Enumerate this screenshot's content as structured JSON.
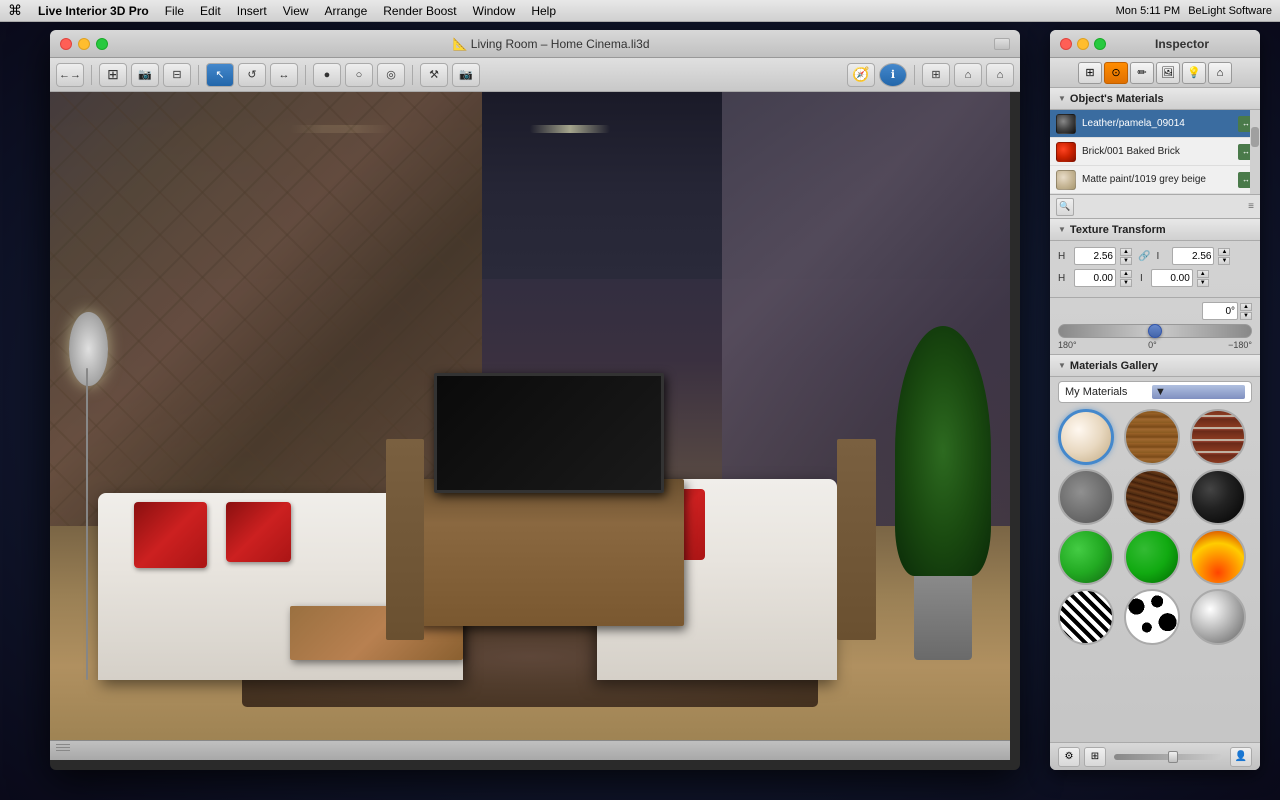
{
  "menubar": {
    "apple": "⌘",
    "items": [
      "Live Interior 3D Pro",
      "File",
      "Edit",
      "Insert",
      "View",
      "Arrange",
      "Render Boost",
      "Window",
      "Help"
    ],
    "right": {
      "time": "Mon 5:11 PM",
      "company": "BeLight Software"
    }
  },
  "window": {
    "title": "Living Room – Home Cinema.li3d",
    "traffic_lights": [
      "close",
      "minimize",
      "maximize"
    ]
  },
  "toolbar": {
    "buttons": [
      "←→",
      "⊞",
      "⊟",
      "⊠",
      "↖",
      "↺",
      "↔",
      "●",
      "○",
      "◎",
      "⚒",
      "📷",
      "🧭",
      "ℹ",
      "⊞",
      "⌂",
      "⌂"
    ]
  },
  "inspector": {
    "title": "Inspector",
    "tabs": [
      "obj",
      "mat",
      "edit",
      "tex",
      "light",
      "scene"
    ],
    "sections": {
      "objects_materials": {
        "label": "Object's Materials",
        "items": [
          {
            "name": "Leather/pamela_09014",
            "swatch_color": "#555555",
            "selected": true
          },
          {
            "name": "Brick/001 Baked Brick",
            "swatch_color": "#cc3300",
            "selected": false
          },
          {
            "name": "Matte paint/1019 grey beige",
            "swatch_color": "#d4c4a0",
            "selected": false
          }
        ]
      },
      "texture_transform": {
        "label": "Texture Transform",
        "fields": {
          "h1_label": "H",
          "h1_value": "2.56",
          "v1_label": "I",
          "v1_value": "2.56",
          "h2_label": "H",
          "h2_value": "0.00",
          "v2_label": "I",
          "v2_value": "0.00",
          "angle_label": "0°",
          "angle_min": "180°",
          "angle_zero": "0°",
          "angle_max": "−180°"
        }
      },
      "materials_gallery": {
        "label": "Materials Gallery",
        "dropdown_value": "My Materials",
        "items": [
          {
            "type": "cream",
            "label": "cream sphere"
          },
          {
            "type": "wood1",
            "label": "light wood"
          },
          {
            "type": "brick",
            "label": "brick"
          },
          {
            "type": "concrete",
            "label": "concrete"
          },
          {
            "type": "darkwood",
            "label": "dark wood"
          },
          {
            "type": "black",
            "label": "black"
          },
          {
            "type": "green1",
            "label": "green sphere"
          },
          {
            "type": "green2",
            "label": "dark green sphere"
          },
          {
            "type": "fire",
            "label": "fire sphere"
          },
          {
            "type": "zebra",
            "label": "zebra sphere"
          },
          {
            "type": "dalmatian",
            "label": "dalmatian sphere"
          },
          {
            "type": "silver",
            "label": "silver sphere"
          }
        ]
      }
    }
  }
}
